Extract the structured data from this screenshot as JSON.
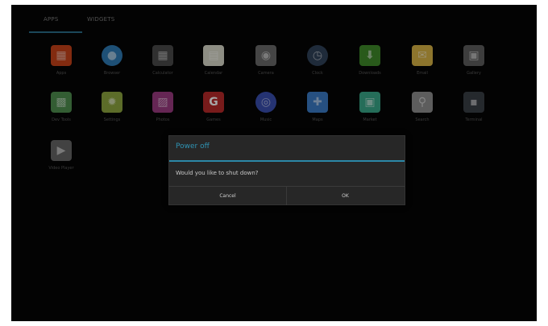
{
  "tabs": [
    {
      "label": "APPS"
    },
    {
      "label": "WIDGETS"
    }
  ],
  "apps": [
    {
      "name": "Apps",
      "icon": "movie-film-icon",
      "color": "#c8421a"
    },
    {
      "name": "Browser",
      "icon": "globe-icon",
      "color": "#2e7bb6"
    },
    {
      "name": "Calculator",
      "icon": "calculator-icon",
      "color": "#4a4a4a"
    },
    {
      "name": "Calendar",
      "icon": "calendar-icon",
      "color": "#d9d9c9"
    },
    {
      "name": "Camera",
      "icon": "camera-icon",
      "color": "#6a6a6a"
    },
    {
      "name": "Clock",
      "icon": "clock-icon",
      "color": "#31435a"
    },
    {
      "name": "Downloads",
      "icon": "download-icon",
      "color": "#3f8a2a"
    },
    {
      "name": "Email",
      "icon": "email-icon",
      "color": "#d9b446"
    },
    {
      "name": "Gallery",
      "icon": "gallery-icon",
      "color": "#5e5e5e"
    },
    {
      "name": "Dev Tools",
      "icon": "dev-tools-icon",
      "color": "#4f8f4f"
    },
    {
      "name": "Settings",
      "icon": "settings-gear-icon",
      "color": "#8ea640"
    },
    {
      "name": "Photos",
      "icon": "photos-icon",
      "color": "#9b3b82"
    },
    {
      "name": "Games",
      "icon": "google-g-icon",
      "color": "#b82a2a"
    },
    {
      "name": "Music",
      "icon": "music-icon",
      "color": "#3a4fb0"
    },
    {
      "name": "Maps",
      "icon": "maps-icon",
      "color": "#3b7bc7"
    },
    {
      "name": "Market",
      "icon": "market-icon",
      "color": "#3aa889"
    },
    {
      "name": "Search",
      "icon": "search-icon",
      "color": "#8f8f8f"
    },
    {
      "name": "Terminal",
      "icon": "terminal-icon",
      "color": "#3a3f46"
    },
    {
      "name": "Video Player",
      "icon": "video-player-icon",
      "color": "#666666"
    }
  ],
  "dialog": {
    "title": "Power off",
    "message": "Would you like to shut down?",
    "cancel_label": "Cancel",
    "ok_label": "OK"
  },
  "colors": {
    "accent": "#2f93b3",
    "background": "#050505"
  }
}
